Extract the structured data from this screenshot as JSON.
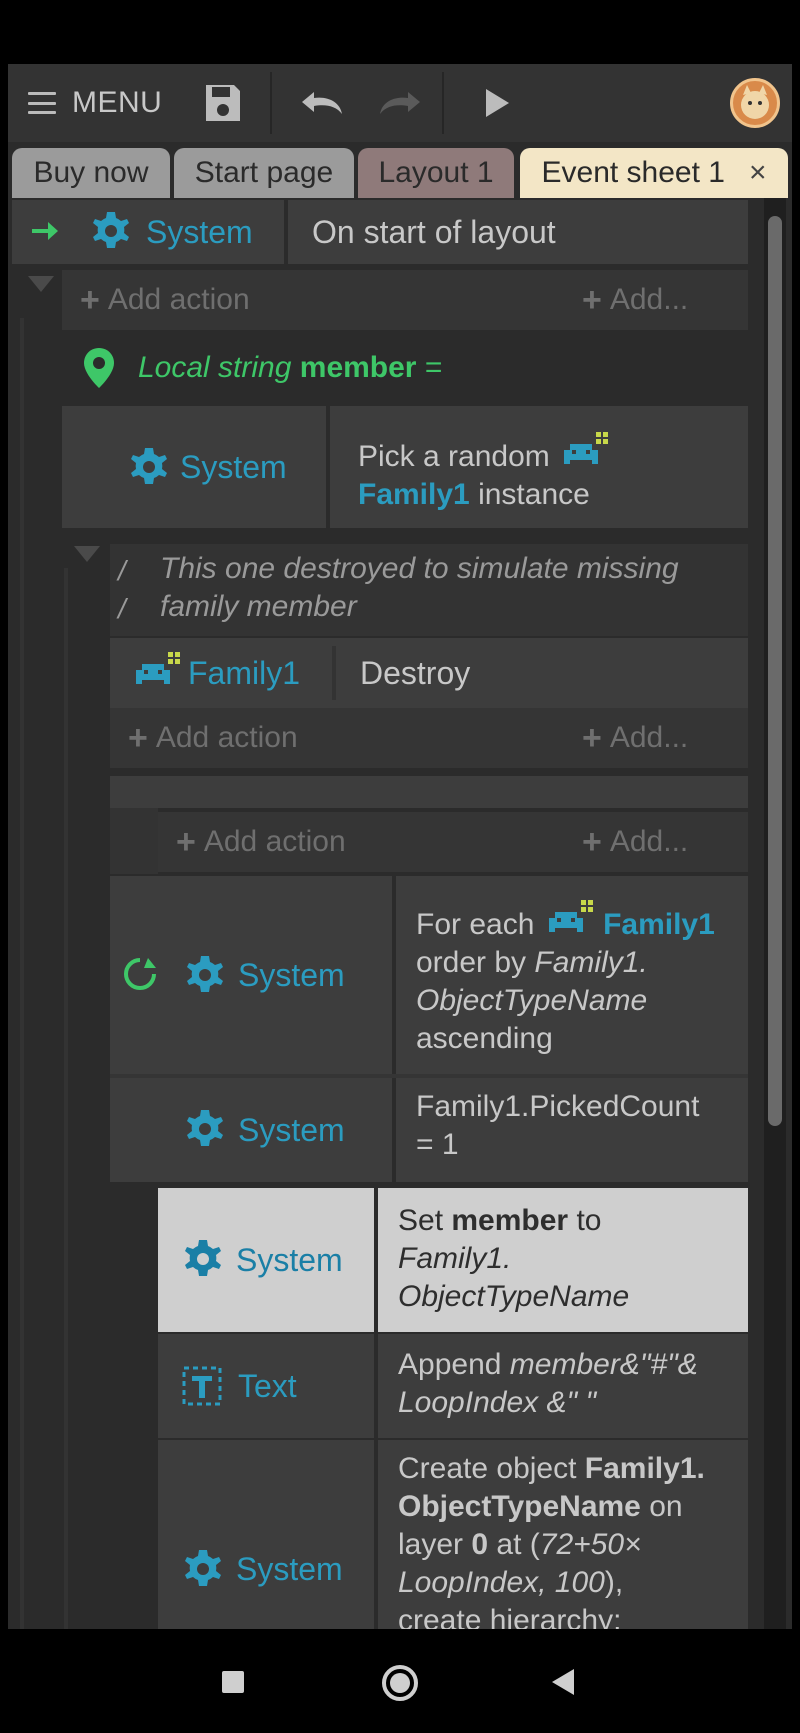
{
  "toolbar": {
    "menu_label": "MENU",
    "icons": [
      "hamburger-icon",
      "save-icon",
      "undo-icon",
      "redo-icon",
      "play-icon",
      "avatar"
    ]
  },
  "tabs": [
    {
      "label": "Buy now",
      "color": "#9b9b9b"
    },
    {
      "label": "Start page",
      "color": "#9b9b9b"
    },
    {
      "label": "Layout 1",
      "color": "#8f7a7a"
    },
    {
      "label": "Event sheet 1",
      "color": "#f3e6c6",
      "close": "×"
    }
  ],
  "events": {
    "e1": {
      "object": "System",
      "condition": "On start of layout"
    },
    "add_action": "Add action",
    "add_more": "Add...",
    "local_var": {
      "prefix": "Local string",
      "name": "member",
      "suffix": "="
    },
    "e2": {
      "object": "System",
      "cond_prefix": "Pick a random",
      "cond_family": "Family1",
      "cond_suffix": "instance"
    },
    "comment": {
      "line1": "This one destroyed to simulate missing",
      "line2": "family member"
    },
    "e3": {
      "object": "Family1",
      "action": "Destroy"
    },
    "e4": {
      "object": "System",
      "cond_for_each": "For each",
      "cond_family": "Family1",
      "cond_line2_a": "order by",
      "cond_line2_b": "Family1.",
      "cond_line3": "ObjectTypeName",
      "cond_line4": "ascending"
    },
    "e5": {
      "object": "System",
      "cond_line1": "Family1.PickedCount",
      "cond_line2": "= 1"
    },
    "a1": {
      "object": "System",
      "p1": "Set",
      "p2": "member",
      "p3": "to",
      "line2": "Family1.",
      "line3": "ObjectTypeName"
    },
    "a2": {
      "object": "Text",
      "p1": "Append",
      "p2": "member&\"#\"&",
      "line2": "LoopIndex &\" \""
    },
    "a3": {
      "object": "System",
      "l1a": "Create object",
      "l1b": "Family1.",
      "l2a": "ObjectTypeName",
      "l2b": "on",
      "l3a": "layer",
      "l3b": "0",
      "l3c": "at (",
      "l3d": "72+50×",
      "l4a": "LoopIndex, 100",
      "l4b": "),",
      "l5": "create hierarchy:"
    }
  },
  "colors": {
    "accent_cyan": "#2b9cc0",
    "accent_green": "#3ec768",
    "selected_row": "#cfcfcf"
  },
  "navbar": {
    "icons": [
      "recents-square-icon",
      "home-circle-icon",
      "back-triangle-icon"
    ]
  }
}
